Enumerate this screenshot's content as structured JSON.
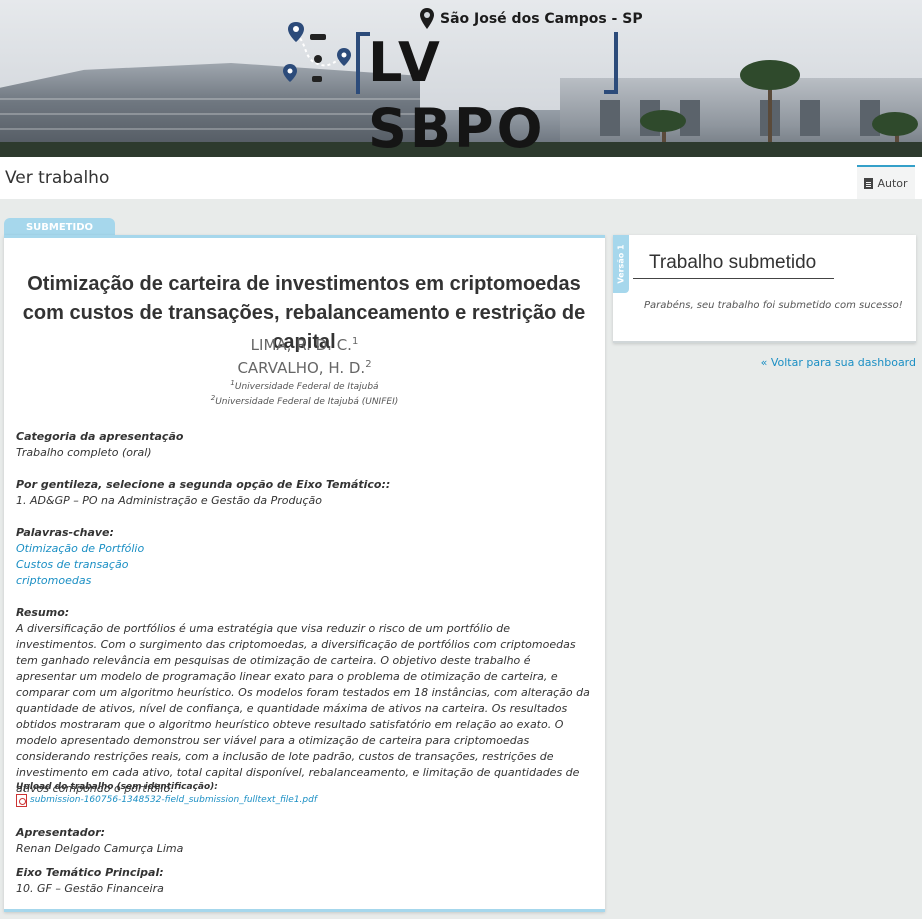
{
  "banner": {
    "location": "São José dos Campos - SP",
    "event_logo": "LV SBPO"
  },
  "header": {
    "page_title": "Ver trabalho",
    "tab_autor": "Autor"
  },
  "status_badge": "SUBMETIDO",
  "paper": {
    "title": "Otimização de carteira de investimentos em criptomoedas com custos de transações, rebalanceamento e restrição de capital",
    "authors": [
      {
        "name": "LIMA, R. D. C.",
        "sup": "1"
      },
      {
        "name": "CARVALHO, H. D.",
        "sup": "2"
      }
    ],
    "affiliations": [
      {
        "sup": "1",
        "name": "Universidade Federal de Itajubá"
      },
      {
        "sup": "2",
        "name": "Universidade Federal de Itajubá (UNIFEI)"
      }
    ],
    "categoria_label": "Categoria da apresentação",
    "categoria_value": "Trabalho completo (oral)",
    "eixo2_label": "Por gentileza, selecione a segunda opção de Eixo Temático::",
    "eixo2_value": "1. AD&GP – PO na Administração e Gestão da Produção",
    "keywords_label": "Palavras-chave:",
    "keywords": [
      "Otimização de Portfólio",
      "Custos de transação",
      "criptomoedas"
    ],
    "resumo_label": "Resumo:",
    "resumo": "A diversificação de portfólios é uma estratégia que visa reduzir o risco de um portfólio de investimentos. Com o surgimento das criptomoedas, a diversificação de portfólios com criptomoedas tem ganhado relevância em pesquisas de otimização de carteira. O objetivo deste trabalho é apresentar um modelo de programação linear exato para o problema de otimização de carteira, e comparar com um algoritmo heurístico. Os modelos foram testados em 18 instâncias, com alteração da quantidade de ativos, nível de confiança, e quantidade máxima de ativos na carteira. Os resultados obtidos mostraram que o algoritmo heurístico obteve resultado satisfatório em relação ao exato. O modelo apresentado demonstrou ser viável para a otimização de carteira para criptomoedas considerando restrições reais, com a inclusão de lote padrão, custos de transações, restrições de investimento em cada ativo, total capital disponível, rebalanceamento, e limitação de quantidades de ativos compondo o portfólio.",
    "upload_label": "Upload do trabalho (sem identificação):",
    "upload_file": "submission-160756-1348532-field_submission_fulltext_file1.pdf",
    "apresentador_label": "Apresentador:",
    "apresentador_value": "Renan Delgado Camurça Lima",
    "eixo_principal_label": "Eixo Temático Principal:",
    "eixo_principal_value": "10. GF – Gestão Financeira"
  },
  "side": {
    "version_tag": "Versão 1",
    "title": "Trabalho submetido",
    "message": "Parabéns, seu trabalho foi submetido com sucesso!",
    "back_link": "« Voltar para sua dashboard"
  },
  "colors": {
    "accent": "#a6d7ec",
    "link": "#1b8fc4",
    "tab_border": "#34a0c9"
  }
}
